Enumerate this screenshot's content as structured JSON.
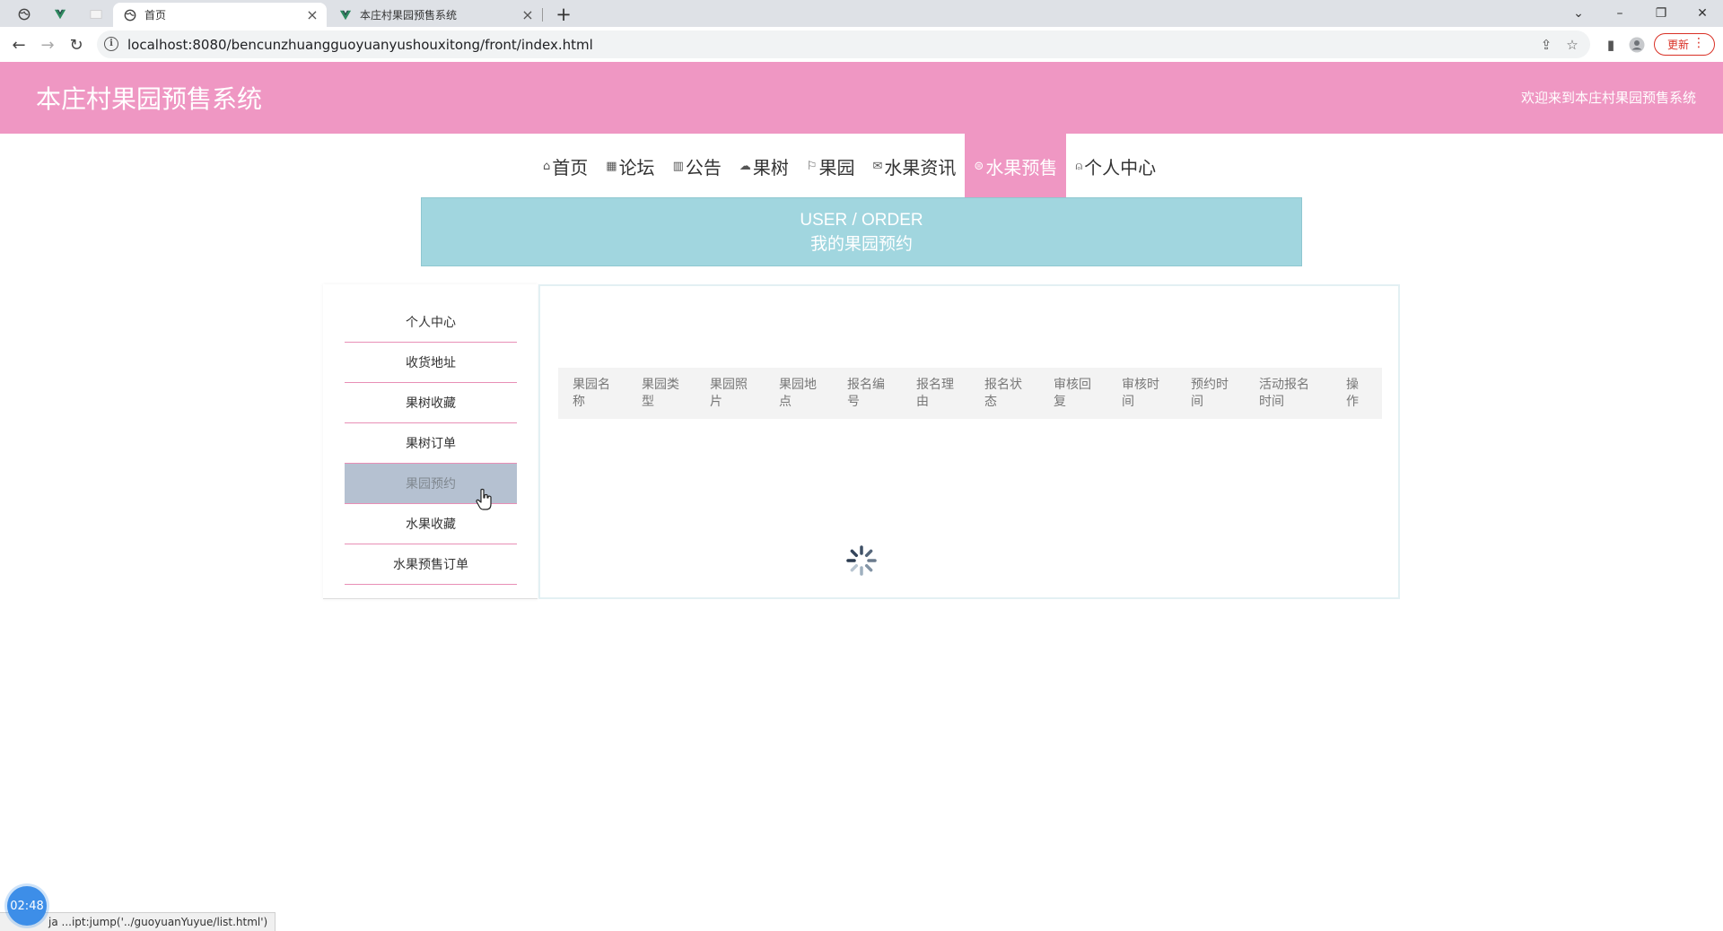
{
  "browser": {
    "tabs": [
      {
        "title": "首页",
        "active": true
      },
      {
        "title": "本庄村果园预售系统",
        "active": false
      }
    ],
    "url": "localhost:8080/bencunzhuangguoyuanyushouxitong/front/index.html",
    "update_label": "更新"
  },
  "header": {
    "title": "本庄村果园预售系统",
    "welcome": "欢迎来到本庄村果园预售系统"
  },
  "nav": [
    {
      "label": "首页",
      "icon": "home-icon",
      "active": false
    },
    {
      "label": "论坛",
      "icon": "forum-icon",
      "active": false
    },
    {
      "label": "公告",
      "icon": "notice-icon",
      "active": false
    },
    {
      "label": "果树",
      "icon": "tree-icon",
      "active": false
    },
    {
      "label": "果园",
      "icon": "flag-icon",
      "active": false
    },
    {
      "label": "水果资讯",
      "icon": "mail-icon",
      "active": false
    },
    {
      "label": "水果预售",
      "icon": "presale-icon",
      "active": true
    },
    {
      "label": "个人中心",
      "icon": "user-icon",
      "active": false
    }
  ],
  "banner": {
    "en": "USER / ORDER",
    "cn": "我的果园预约"
  },
  "sidebar": [
    {
      "label": "个人中心"
    },
    {
      "label": "收货地址"
    },
    {
      "label": "果树收藏"
    },
    {
      "label": "果树订单"
    },
    {
      "label": "果园预约",
      "active": true
    },
    {
      "label": "水果收藏"
    },
    {
      "label": "水果预售订单"
    }
  ],
  "table": {
    "columns": [
      "果园名称",
      "果园类型",
      "果园照片",
      "果园地点",
      "报名编号",
      "报名理由",
      "报名状态",
      "审核回复",
      "审核时间",
      "预约时间",
      "活动报名时间",
      "操作"
    ]
  },
  "overlay": {
    "timer": "02:48",
    "status_text": "ja   ...ipt:jump('../guoyuanYuyue/list.html')"
  },
  "colors": {
    "header_bg": "#ef97c3",
    "banner_bg": "#a1d6df",
    "sidebar_active_bg": "#b5c1d1"
  }
}
